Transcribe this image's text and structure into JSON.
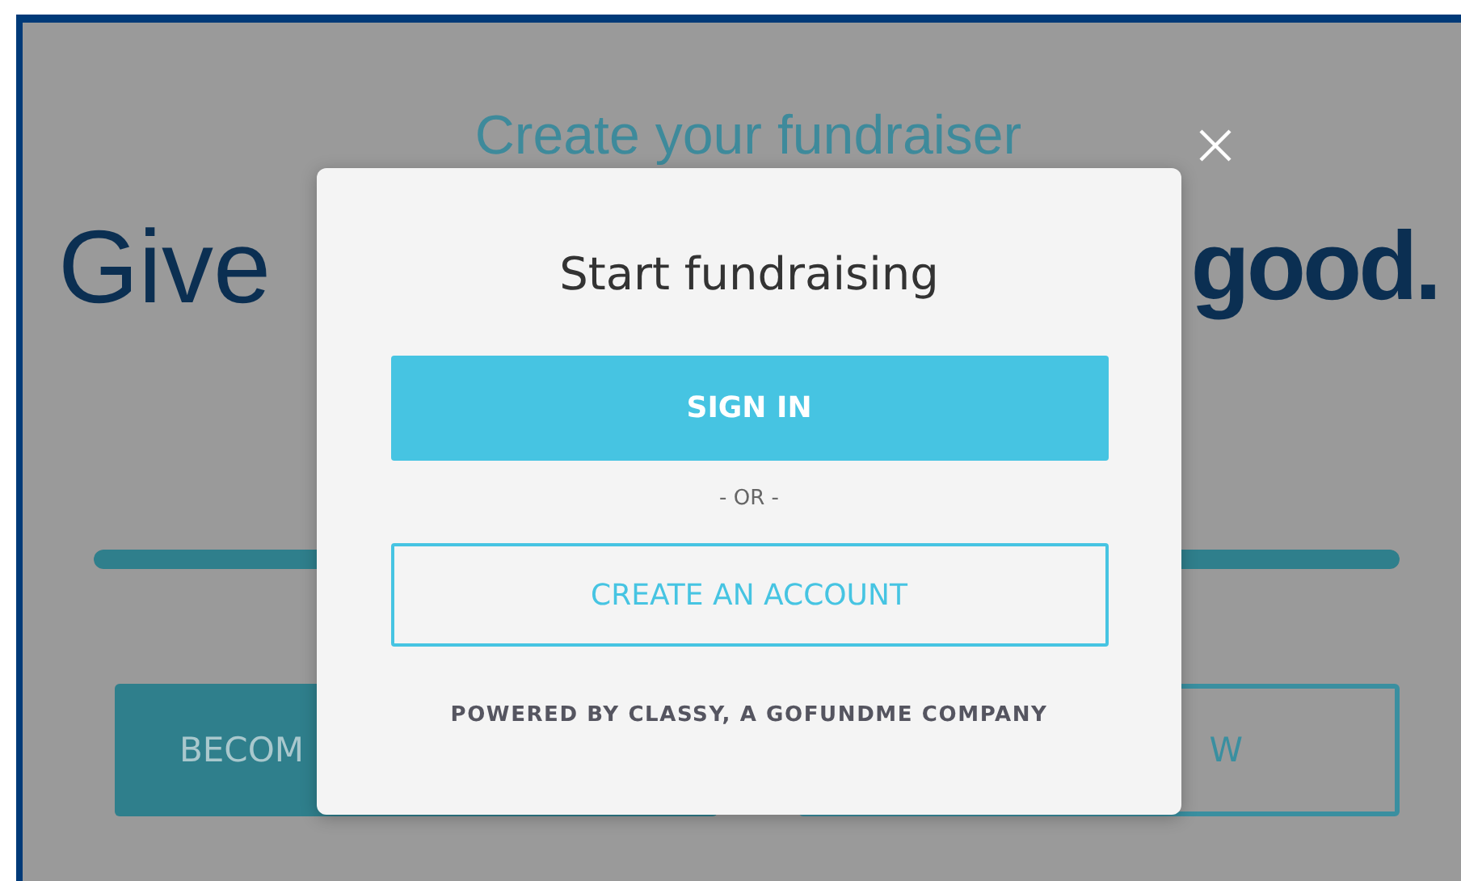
{
  "background": {
    "subtitle": "Create your fundraiser",
    "heading_start": "Give",
    "heading_end": "good.",
    "progress": {
      "level": 1
    },
    "buttons": [
      {
        "label": "BECOM",
        "kind": "filled"
      },
      {
        "label": "W",
        "kind": "outline"
      }
    ]
  },
  "modal": {
    "title": "Start fundraising",
    "primary_button": "SIGN IN",
    "separator": "- OR -",
    "secondary_button": "CREATE AN ACCOUNT",
    "footer": "POWERED BY CLASSY, A GOFUNDME COMPANY"
  }
}
